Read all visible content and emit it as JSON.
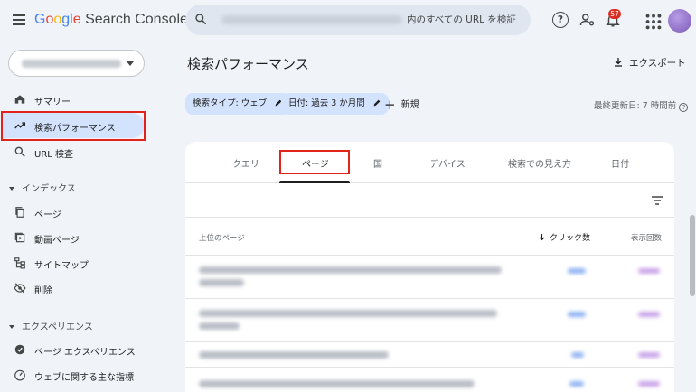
{
  "app": {
    "logo_letters": [
      "G",
      "o",
      "o",
      "g",
      "l",
      "e"
    ],
    "logo_rest": " Search Console"
  },
  "search": {
    "text": "内のすべての URL を検証"
  },
  "topbar": {
    "help_glyph": "?",
    "notification_count": "57"
  },
  "sidebar": {
    "items": [
      {
        "label": "サマリー",
        "icon": "home-icon"
      },
      {
        "label": "検索パフォーマンス",
        "icon": "trending-up-icon",
        "active": true
      },
      {
        "label": "URL 検査",
        "icon": "search-icon"
      }
    ],
    "sections": [
      {
        "label": "インデックス",
        "items": [
          {
            "label": "ページ",
            "icon": "pages-icon"
          },
          {
            "label": "動画ページ",
            "icon": "video-page-icon"
          },
          {
            "label": "サイトマップ",
            "icon": "sitemap-icon"
          },
          {
            "label": "削除",
            "icon": "removals-icon"
          }
        ]
      },
      {
        "label": "エクスペリエンス",
        "items": [
          {
            "label": "ページ エクスペリエンス",
            "icon": "page-experience-icon"
          },
          {
            "label": "ウェブに関する主な指標",
            "icon": "core-web-vitals-icon"
          }
        ]
      }
    ]
  },
  "main": {
    "title": "検索パフォーマンス",
    "export_label": "エクスポート",
    "chips": [
      {
        "label": "検索タイプ: ウェブ"
      },
      {
        "label": "日付: 過去 3 か月間"
      }
    ],
    "new_label": "新規",
    "plus_glyph": "+",
    "last_updated": "最終更新日: 7 時間前",
    "tabs": [
      "クエリ",
      "ページ",
      "国",
      "デバイス",
      "検索での見え方",
      "日付"
    ],
    "active_tab": "ページ",
    "table": {
      "headers": {
        "page": "上位のページ",
        "clicks": "クリック数",
        "impressions": "表示回数"
      }
    }
  },
  "colors": {
    "highlight_box": "#e0241a",
    "active_nav": "#d3e3fd",
    "chip_bg": "#d3e3fd",
    "badge": "#d93025"
  }
}
